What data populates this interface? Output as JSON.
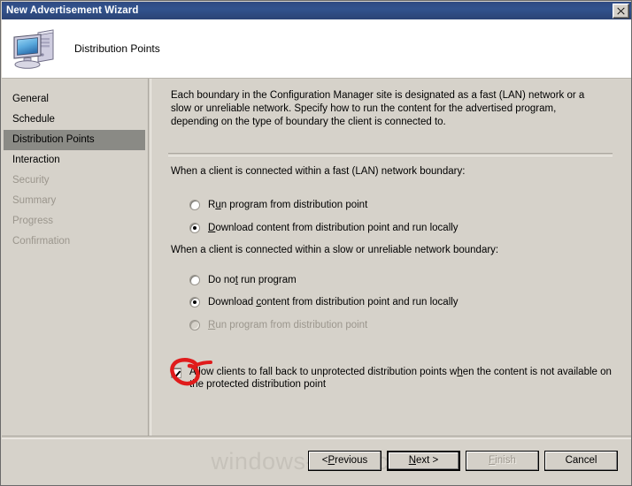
{
  "window": {
    "title": "New Advertisement Wizard",
    "close_label": "✕"
  },
  "header": {
    "title": "Distribution Points",
    "icon": "computer-icon"
  },
  "sidebar": {
    "items": [
      {
        "label": "General",
        "state": "enabled"
      },
      {
        "label": "Schedule",
        "state": "enabled"
      },
      {
        "label": "Distribution Points",
        "state": "active"
      },
      {
        "label": "Interaction",
        "state": "enabled"
      },
      {
        "label": "Security",
        "state": "disabled"
      },
      {
        "label": "Summary",
        "state": "disabled"
      },
      {
        "label": "Progress",
        "state": "disabled"
      },
      {
        "label": "Confirmation",
        "state": "disabled"
      }
    ]
  },
  "content": {
    "intro": "Each boundary in the Configuration Manager site is designated as a fast (LAN) network or a slow or unreliable network. Specify how to run the content for the advertised program, depending on the type of boundary the client is connected to.",
    "fast_group": {
      "label": "When a client is connected within a fast (LAN) network boundary:",
      "options": [
        {
          "label_pre": "R",
          "label_key": "u",
          "label_post": "n program from distribution point",
          "selected": false,
          "disabled": false
        },
        {
          "label_pre": "",
          "label_key": "D",
          "label_post": "ownload content from distribution point and run locally",
          "selected": true,
          "disabled": false
        }
      ]
    },
    "slow_group": {
      "label": "When a client is connected within a slow or unreliable network boundary:",
      "options": [
        {
          "label_pre": "Do no",
          "label_key": "t",
          "label_post": " run program",
          "selected": false,
          "disabled": false
        },
        {
          "label_pre": "Download ",
          "label_key": "c",
          "label_post": "ontent from distribution point and run locally",
          "selected": true,
          "disabled": false
        },
        {
          "label_pre": "",
          "label_key": "R",
          "label_post": "un program from distribution point",
          "selected": false,
          "disabled": true
        }
      ]
    },
    "fallback_checkbox": {
      "label_pre": "Allow clients to fall back to unprotected distribution points w",
      "label_key": "h",
      "label_post": "en the content is not available on the protected distribution point",
      "checked": true
    }
  },
  "annotation": {
    "shape": "red-circle-highlight",
    "color": "#e01b1b"
  },
  "footer": {
    "watermark": "windows-noob.com",
    "buttons": [
      {
        "pre": "< ",
        "key": "P",
        "post": "revious",
        "state": "enabled",
        "default": false
      },
      {
        "pre": "",
        "key": "N",
        "post": "ext >",
        "state": "enabled",
        "default": true
      },
      {
        "pre": "",
        "key": "F",
        "post": "inish",
        "state": "disabled",
        "default": false
      },
      {
        "pre": "",
        "key": "",
        "post": "Cancel",
        "state": "enabled",
        "default": false
      }
    ]
  }
}
